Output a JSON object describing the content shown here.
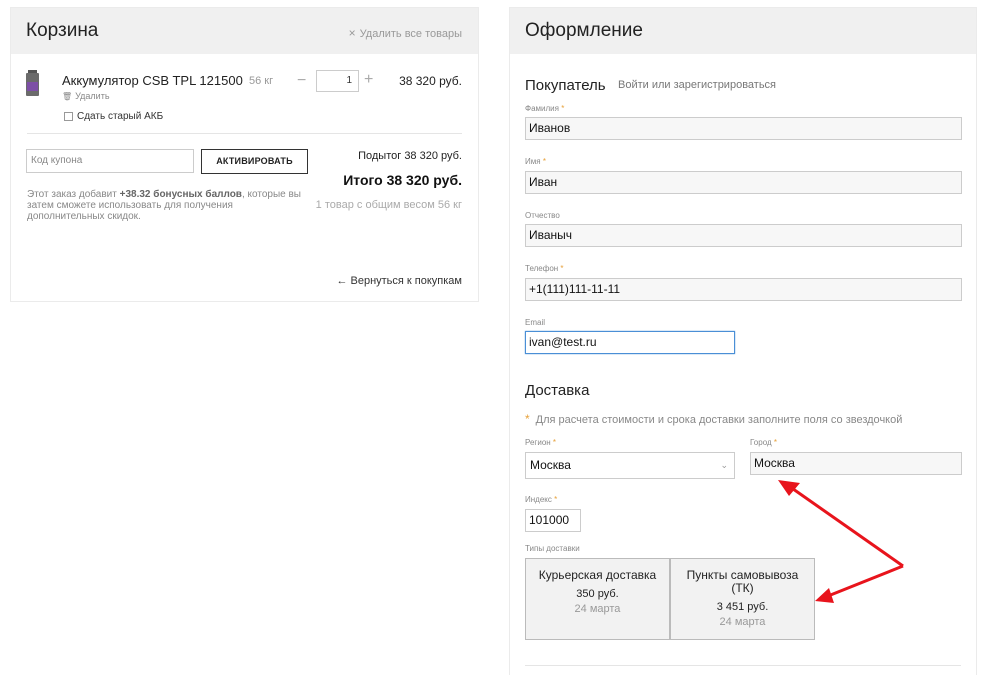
{
  "cart": {
    "title": "Корзина",
    "clear_all_icon": "×",
    "clear_all_label": "Удалить все товары",
    "item": {
      "name": "Аккумулятор CSB TPL 121500",
      "weight": "56 кг",
      "remove_icon": "🗑",
      "remove_label": "Удалить",
      "qty_minus": "−",
      "qty": "1",
      "qty_plus": "+",
      "price": "38 320 руб."
    },
    "trade_in_label": "Сдать старый АКБ",
    "coupon_placeholder": "Код купона",
    "activate_label": "АКТИВИРОВАТЬ",
    "subtotal": "Подытог 38 320 руб.",
    "total": "Итого 38 320 руб.",
    "weight_note": "1 товар с общим весом 56 кг",
    "bonus_note_prefix": "Этот заказ добавит ",
    "bonus_note_bold": "+38.32 бонусных баллов",
    "bonus_note_suffix": ", которые вы затем сможете использовать для получения дополнительных скидок.",
    "back_link": "← Вернуться к покупкам"
  },
  "checkout": {
    "title": "Оформление",
    "buyer_title": "Покупатель",
    "login_link": "Войти или зарегистрироваться",
    "req_mark": "*",
    "fields": {
      "lastname_label": "Фамилия",
      "lastname_value": "Иванов",
      "firstname_label": "Имя",
      "firstname_value": "Иван",
      "middlename_label": "Отчество",
      "middlename_value": "Иваныч",
      "phone_label": "Телефон",
      "phone_value": "+1(111)111-11-11",
      "email_label": "Email",
      "email_value": "ivan@test.ru"
    },
    "delivery_title": "Доставка",
    "delivery_note_star": "*",
    "delivery_note": "Для расчета стоимости и срока доставки заполните поля со звездочкой",
    "region_label": "Регион",
    "region_value": "Москва",
    "region_caret": "⌄",
    "city_label": "Город",
    "city_value": "Москва",
    "index_label": "Индекс",
    "index_value": "101000",
    "delivery_types_label": "Типы доставки",
    "delivery_types": [
      {
        "name": "Курьерская доставка",
        "price": "350 руб.",
        "date": "24 марта"
      },
      {
        "name": "Пункты самовывоза (ТК)",
        "price": "3 451 руб.",
        "date": "24 марта"
      }
    ]
  },
  "annotation_color": "#e8141c"
}
